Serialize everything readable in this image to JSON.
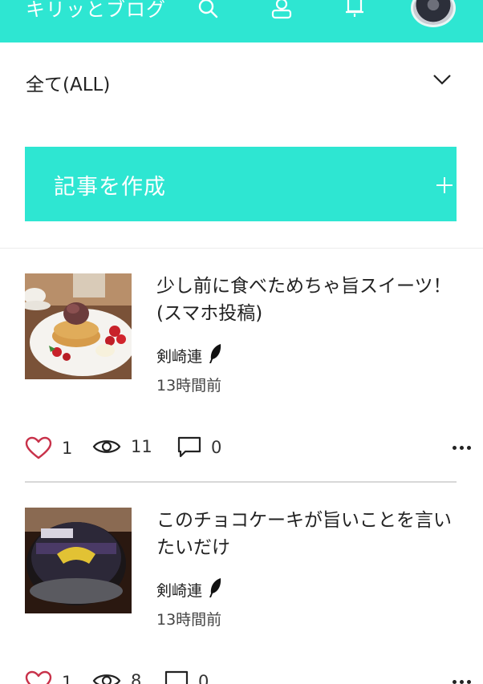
{
  "header": {
    "title": "キリッとブログ",
    "icons": [
      "search-icon",
      "profile-icon",
      "bell-icon",
      "avatar"
    ],
    "accent_color": "#2ee6d2"
  },
  "filter": {
    "selected": "全て(ALL)",
    "icon": "chevron-down-icon"
  },
  "create_button": {
    "label": "記事を作成",
    "icon": "plus-icon"
  },
  "posts": [
    {
      "title": "少し前に食べためちゃ旨スイーツ！(スマホ投稿)",
      "author": "剣崎連",
      "time": "13時間前",
      "likes": "1",
      "views": "11",
      "comments": "0"
    },
    {
      "title": "このチョコケーキが旨いことを言いたいだけ",
      "author": "剣崎連",
      "time": "13時間前",
      "likes": "1",
      "views": "8",
      "comments": "0"
    }
  ]
}
